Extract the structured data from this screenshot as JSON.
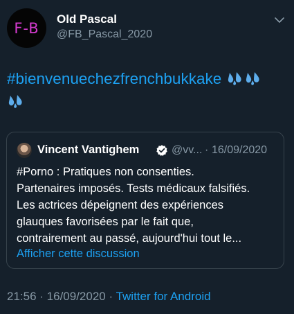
{
  "author": {
    "avatar_text": "F-B",
    "name": "Old Pascal",
    "handle": "@FB_Pascal_2020"
  },
  "tweet": {
    "hashtag_text": "#bienvenuechezfrenchbukkake",
    "emoji": "sweat-droplets"
  },
  "quoted_tweet": {
    "name": "Vincent Vantighem",
    "handle": "@vv...",
    "separator": "·",
    "date": "16/09/2020",
    "text": "#Porno : Pratiques non consenties.\nPartenaires imposés. Tests médicaux falsifiés.\nLes actrices dépeignent des expériences\nglauques favorisées par le fait que,\ncontrairement au passé, aujourd'hui tout le...",
    "link_label": "Afficher cette discussion"
  },
  "footer": {
    "time": "21:56",
    "sep1": " · ",
    "date": "16/09/2020",
    "sep2": " · ",
    "source": "Twitter for Android"
  },
  "colors": {
    "background": "#15202b",
    "link": "#1da1f2",
    "muted": "#8899a6",
    "border": "#38444d",
    "avatar_text": "#d63bd0"
  }
}
